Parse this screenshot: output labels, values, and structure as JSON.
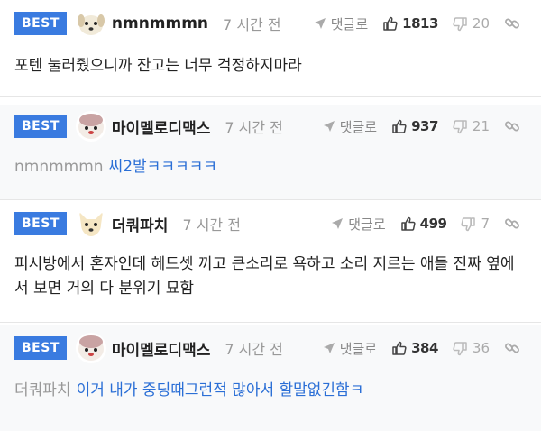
{
  "comments": [
    {
      "best": "BEST",
      "nick": "nmnmmmn",
      "time": "7 시간 전",
      "reply_label": "댓글로",
      "likes": "1813",
      "dislikes": "20",
      "text": "포텐 눌러줬으니까 잔고는 너무 걱정하지마라",
      "avatar": "puppy-avatar"
    },
    {
      "best": "BEST",
      "nick": "마이멜로디맥스",
      "time": "7 시간 전",
      "reply_label": "댓글로",
      "likes": "937",
      "dislikes": "21",
      "mention": "nmnmmmn",
      "text": "씨2발ㅋㅋㅋㅋㅋ",
      "avatar": "melody-avatar"
    },
    {
      "best": "BEST",
      "nick": "더쿼파치",
      "time": "7 시간 전",
      "reply_label": "댓글로",
      "likes": "499",
      "dislikes": "7",
      "text": "피시방에서 혼자인데 헤드셋 끼고 큰소리로 욕하고 소리 지르는 애들 진짜 옆에서 보면 거의 다 분위기 묘함",
      "avatar": "dog-avatar"
    },
    {
      "best": "BEST",
      "nick": "마이멜로디맥스",
      "time": "7 시간 전",
      "reply_label": "댓글로",
      "likes": "384",
      "dislikes": "36",
      "mention": "더쿼파치",
      "text": "이거 내가 중딩때그런적 많아서 할말없긴함ㅋ",
      "avatar": "melody-avatar"
    }
  ],
  "colors": {
    "best_bg": "#3a7be0",
    "reply_text": "#2b6fd6"
  }
}
